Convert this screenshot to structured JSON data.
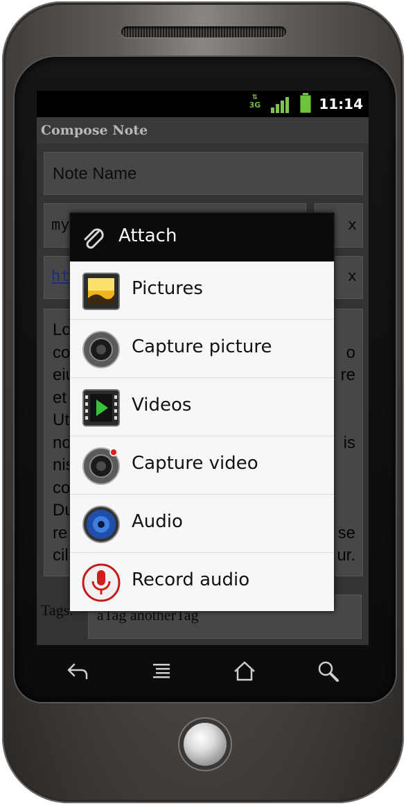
{
  "status_bar": {
    "network": "3G",
    "time": "11:14"
  },
  "app": {
    "title": "Compose Note"
  },
  "form": {
    "note_name": "Note Name",
    "email_partial": "my",
    "email_remove": "x",
    "url_partial": "ht",
    "url_remove": "x",
    "body_lines": [
      [
        "Lo",
        ""
      ],
      [
        "co",
        "o"
      ],
      [
        "eiu",
        "re"
      ],
      [
        "et",
        ""
      ],
      [
        "Ut",
        ""
      ],
      [
        "no",
        "is"
      ],
      [
        "nis",
        ""
      ],
      [
        "co",
        ""
      ],
      [
        "Du",
        ""
      ],
      [
        "re",
        "se"
      ],
      [
        "cil",
        "ur."
      ]
    ],
    "tags_label": "Tags:",
    "tags_value": "aTag anotherTag"
  },
  "dialog": {
    "title": "Attach",
    "items": [
      {
        "label": "Pictures",
        "icon": "pictures-icon"
      },
      {
        "label": "Capture picture",
        "icon": "camera-icon"
      },
      {
        "label": "Videos",
        "icon": "videos-icon"
      },
      {
        "label": "Capture video",
        "icon": "video-camera-icon"
      },
      {
        "label": "Audio",
        "icon": "audio-icon"
      },
      {
        "label": "Record audio",
        "icon": "microphone-icon"
      }
    ]
  },
  "navigation": [
    "back-icon",
    "menu-icon",
    "home-icon",
    "search-icon"
  ]
}
